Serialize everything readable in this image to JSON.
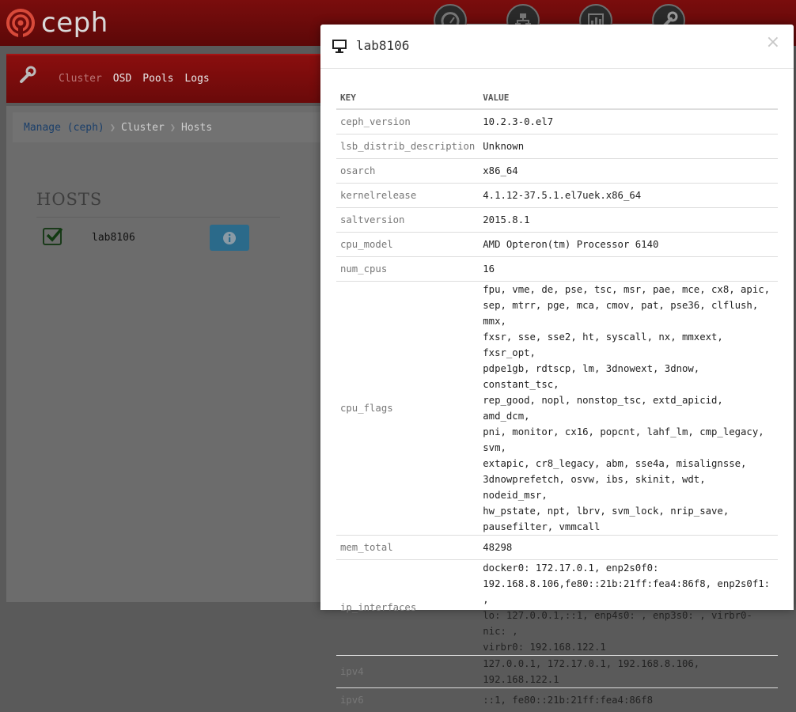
{
  "app": {
    "logo_text": "ceph"
  },
  "top_nav": {
    "icons": [
      "dashboard-icon",
      "hierarchy-icon",
      "bar-chart-icon",
      "wrench-icon"
    ]
  },
  "subnav": {
    "items": [
      "Cluster",
      "OSD",
      "Pools",
      "Logs"
    ]
  },
  "breadcrumb": {
    "items": [
      "Manage (ceph)",
      "Cluster",
      "Hosts"
    ]
  },
  "hosts": {
    "title": "HOSTS",
    "rows": [
      {
        "name": "lab8106",
        "checked": true
      }
    ]
  },
  "modal": {
    "title": "lab8106",
    "close_label": "×",
    "columns": {
      "key": "KEY",
      "value": "VALUE"
    },
    "rows": [
      {
        "key": "ceph_version",
        "value": "10.2.3-0.el7"
      },
      {
        "key": "lsb_distrib_description",
        "value": "Unknown"
      },
      {
        "key": "osarch",
        "value": "x86_64"
      },
      {
        "key": "kernelrelease",
        "value": "4.1.12-37.5.1.el7uek.x86_64"
      },
      {
        "key": "saltversion",
        "value": "2015.8.1"
      },
      {
        "key": "cpu_model",
        "value": "AMD Opteron(tm) Processor 6140"
      },
      {
        "key": "num_cpus",
        "value": "16"
      },
      {
        "key": "cpu_flags",
        "lines": [
          "fpu, vme, de, pse, tsc, msr, pae, mce, cx8, apic,",
          "sep, mtrr, pge, mca, cmov, pat, pse36, clflush, mmx,",
          "fxsr, sse, sse2, ht, syscall, nx, mmxext, fxsr_opt,",
          "pdpe1gb, rdtscp, lm, 3dnowext, 3dnow, constant_tsc,",
          "rep_good, nopl, nonstop_tsc, extd_apicid, amd_dcm,",
          "pni, monitor, cx16, popcnt, lahf_lm, cmp_legacy, svm,",
          "extapic, cr8_legacy, abm, sse4a, misalignsse,",
          "3dnowprefetch, osvw, ibs, skinit, wdt, nodeid_msr,",
          "hw_pstate, npt, lbrv, svm_lock, nrip_save,",
          "pausefilter, vmmcall"
        ]
      },
      {
        "key": "mem_total",
        "value": "48298"
      },
      {
        "key": "ip_interfaces",
        "lines": [
          "docker0: 172.17.0.1, enp2s0f0:",
          "192.168.8.106,fe80::21b:21ff:fea4:86f8, enp2s0f1: ,",
          "lo: 127.0.0.1,::1, enp4s0: , enp3s0: , virbr0-nic: ,",
          "virbr0: 192.168.122.1"
        ]
      },
      {
        "key": "ipv4",
        "value": "127.0.0.1, 172.17.0.1, 192.168.8.106, 192.168.122.1"
      },
      {
        "key": "ipv6",
        "value": "::1, fe80::21b:21ff:fea4:86f8"
      }
    ]
  }
}
